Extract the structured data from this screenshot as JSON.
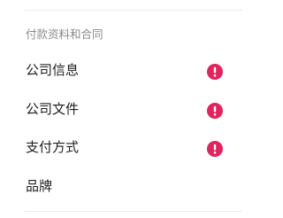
{
  "section": {
    "title": "付款资料和合同"
  },
  "menu": {
    "items": [
      {
        "label": "公司信息",
        "alert": true,
        "icon": "exclamation-circle-icon"
      },
      {
        "label": "公司文件",
        "alert": true,
        "icon": "exclamation-circle-icon"
      },
      {
        "label": "支付方式",
        "alert": true,
        "icon": "exclamation-circle-icon"
      },
      {
        "label": "品牌",
        "alert": false
      }
    ]
  },
  "colors": {
    "alert": "#e0245e",
    "text": "#1f1f1f",
    "section_title": "#8a8a8a",
    "divider": "#ececec"
  }
}
